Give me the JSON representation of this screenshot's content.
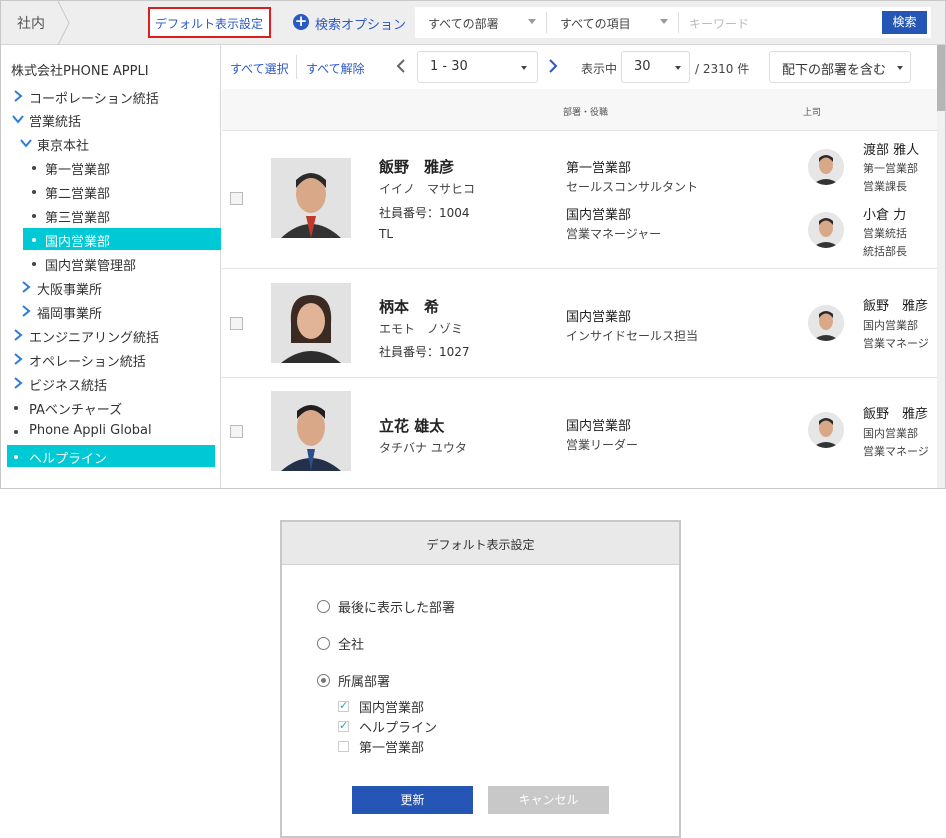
{
  "topbar": {
    "breadcrumb": "社内",
    "default_setting_link": "デフォルト表示設定",
    "search_options_link": "検索オプション",
    "dept_select": "すべての部署",
    "item_select": "すべての項目",
    "keyword_placeholder": "キーワード",
    "search_button": "検索",
    "highlight_color": "#d9201f"
  },
  "sidebar": {
    "company": "株式会社PHONE APPLI",
    "items": [
      {
        "label": "コーポレーション統括",
        "type": "collapsed"
      },
      {
        "label": "営業統括",
        "type": "expanded"
      },
      {
        "label": "東京本社",
        "type": "expanded"
      },
      {
        "label": "第一営業部",
        "type": "leaf"
      },
      {
        "label": "第二営業部",
        "type": "leaf"
      },
      {
        "label": "第三営業部",
        "type": "leaf"
      },
      {
        "label": "国内営業部",
        "type": "leaf",
        "active": true
      },
      {
        "label": "国内営業管理部",
        "type": "leaf"
      },
      {
        "label": "大阪事業所",
        "type": "collapsed"
      },
      {
        "label": "福岡事業所",
        "type": "collapsed"
      },
      {
        "label": "エンジニアリング統括",
        "type": "collapsed"
      },
      {
        "label": "オペレーション統括",
        "type": "collapsed"
      },
      {
        "label": "ビジネス統括",
        "type": "collapsed"
      },
      {
        "label": "PAベンチャーズ",
        "type": "leaf"
      },
      {
        "label": "Phone Appli Global",
        "type": "leaf"
      },
      {
        "label": "ヘルプライン",
        "type": "leaf",
        "active": true
      }
    ],
    "active_color": "#00c9d6"
  },
  "toolbar": {
    "select_all": "すべて選択",
    "deselect_all": "すべて解除",
    "page_range": "1 - 30",
    "showing_label": "表示中",
    "per_page": "30",
    "total": "/ 2310 件",
    "include_sub": "配下の部署を含む"
  },
  "table": {
    "col_dept": "部署・役職",
    "col_boss": "上司"
  },
  "rows": [
    {
      "name": "飯野　雅彦",
      "kana": "イイノ　マサヒコ",
      "emp_no": "社員番号：1004",
      "grade": "TL",
      "positions": [
        {
          "dept": "第一営業部",
          "role": "セールスコンサルタント"
        },
        {
          "dept": "国内営業部",
          "role": "営業マネージャー"
        }
      ],
      "bosses": [
        {
          "name": "渡部 雅人",
          "sub1": "第一営業部",
          "sub2": "営業課長"
        },
        {
          "name": "小倉 力",
          "sub1": "営業統括",
          "sub2": "統括部長"
        }
      ]
    },
    {
      "name": "柄本　希",
      "kana": "エモト　ノゾミ",
      "emp_no": "社員番号：1027",
      "positions": [
        {
          "dept": "国内営業部",
          "role": "インサイドセールス担当"
        }
      ],
      "bosses": [
        {
          "name": "飯野　雅彦",
          "sub1": "国内営業部",
          "sub2": "営業マネージ"
        }
      ]
    },
    {
      "name": "立花 雄太",
      "kana": "タチバナ ユウタ",
      "positions": [
        {
          "dept": "国内営業部",
          "role": "営業リーダー"
        }
      ],
      "bosses": [
        {
          "name": "飯野　雅彦",
          "sub1": "国内営業部",
          "sub2": "営業マネージ"
        }
      ]
    }
  ],
  "dialog": {
    "title": "デフォルト表示設定",
    "options": [
      {
        "label": "最後に表示した部署",
        "selected": false
      },
      {
        "label": "全社",
        "selected": false
      },
      {
        "label": "所属部署",
        "selected": true
      }
    ],
    "departments": [
      {
        "label": "国内営業部",
        "checked": true
      },
      {
        "label": "ヘルプライン",
        "checked": true
      },
      {
        "label": "第一営業部",
        "checked": false
      }
    ],
    "update_button": "更新",
    "cancel_button": "キャンセル",
    "primary_color": "#2656b5"
  }
}
